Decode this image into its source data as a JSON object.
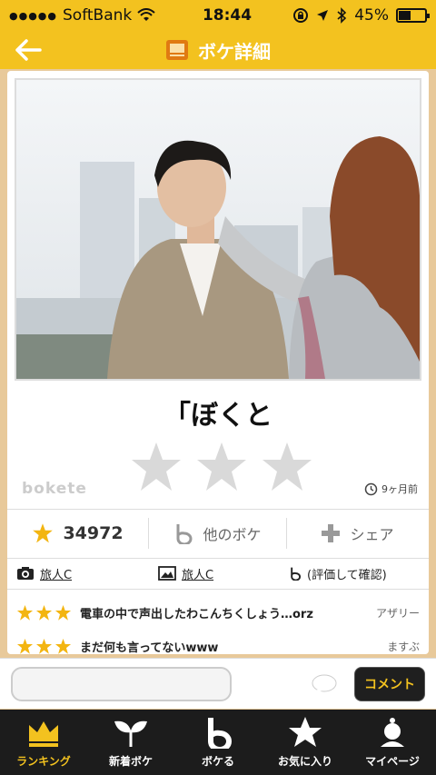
{
  "status_bar": {
    "signal_dots": "●●●●●",
    "carrier": "SoftBank",
    "time": "18:44",
    "battery_percent": "45%",
    "battery_level": 0.45
  },
  "nav": {
    "title": "ボケ詳細"
  },
  "post": {
    "caption": "「ぼくと",
    "rating_stars": 3,
    "watermark": "bokete",
    "age": "9ヶ月前"
  },
  "actions": {
    "score": "34972",
    "other_bokeh": "他のボケ",
    "share": "シェア"
  },
  "meta": {
    "photo_credit": "旅人C",
    "image_credit": "旅人C",
    "rating_hint": "(評価して確認)"
  },
  "bokeh_list": [
    {
      "stars": 3,
      "text": "電車の中で声出したわこんちくしょう…orz",
      "user": "アザリー"
    },
    {
      "stars": 3,
      "text": "まだ何も言ってないwww",
      "user": "ますぶ"
    }
  ],
  "comment": {
    "placeholder": "",
    "button_label": "コメント"
  },
  "tabs": [
    {
      "label": "ランキング",
      "icon": "crown-icon",
      "active": true
    },
    {
      "label": "新着ボケ",
      "icon": "sprout-icon",
      "active": false
    },
    {
      "label": "ボケる",
      "icon": "b-logo-icon",
      "active": false
    },
    {
      "label": "お気に入り",
      "icon": "star-icon",
      "active": false
    },
    {
      "label": "マイページ",
      "icon": "figure-icon",
      "active": false
    }
  ],
  "colors": {
    "brand_yellow": "#f3c21f",
    "tab_bar": "#1c1c1c",
    "star_gold": "#f3b511"
  }
}
